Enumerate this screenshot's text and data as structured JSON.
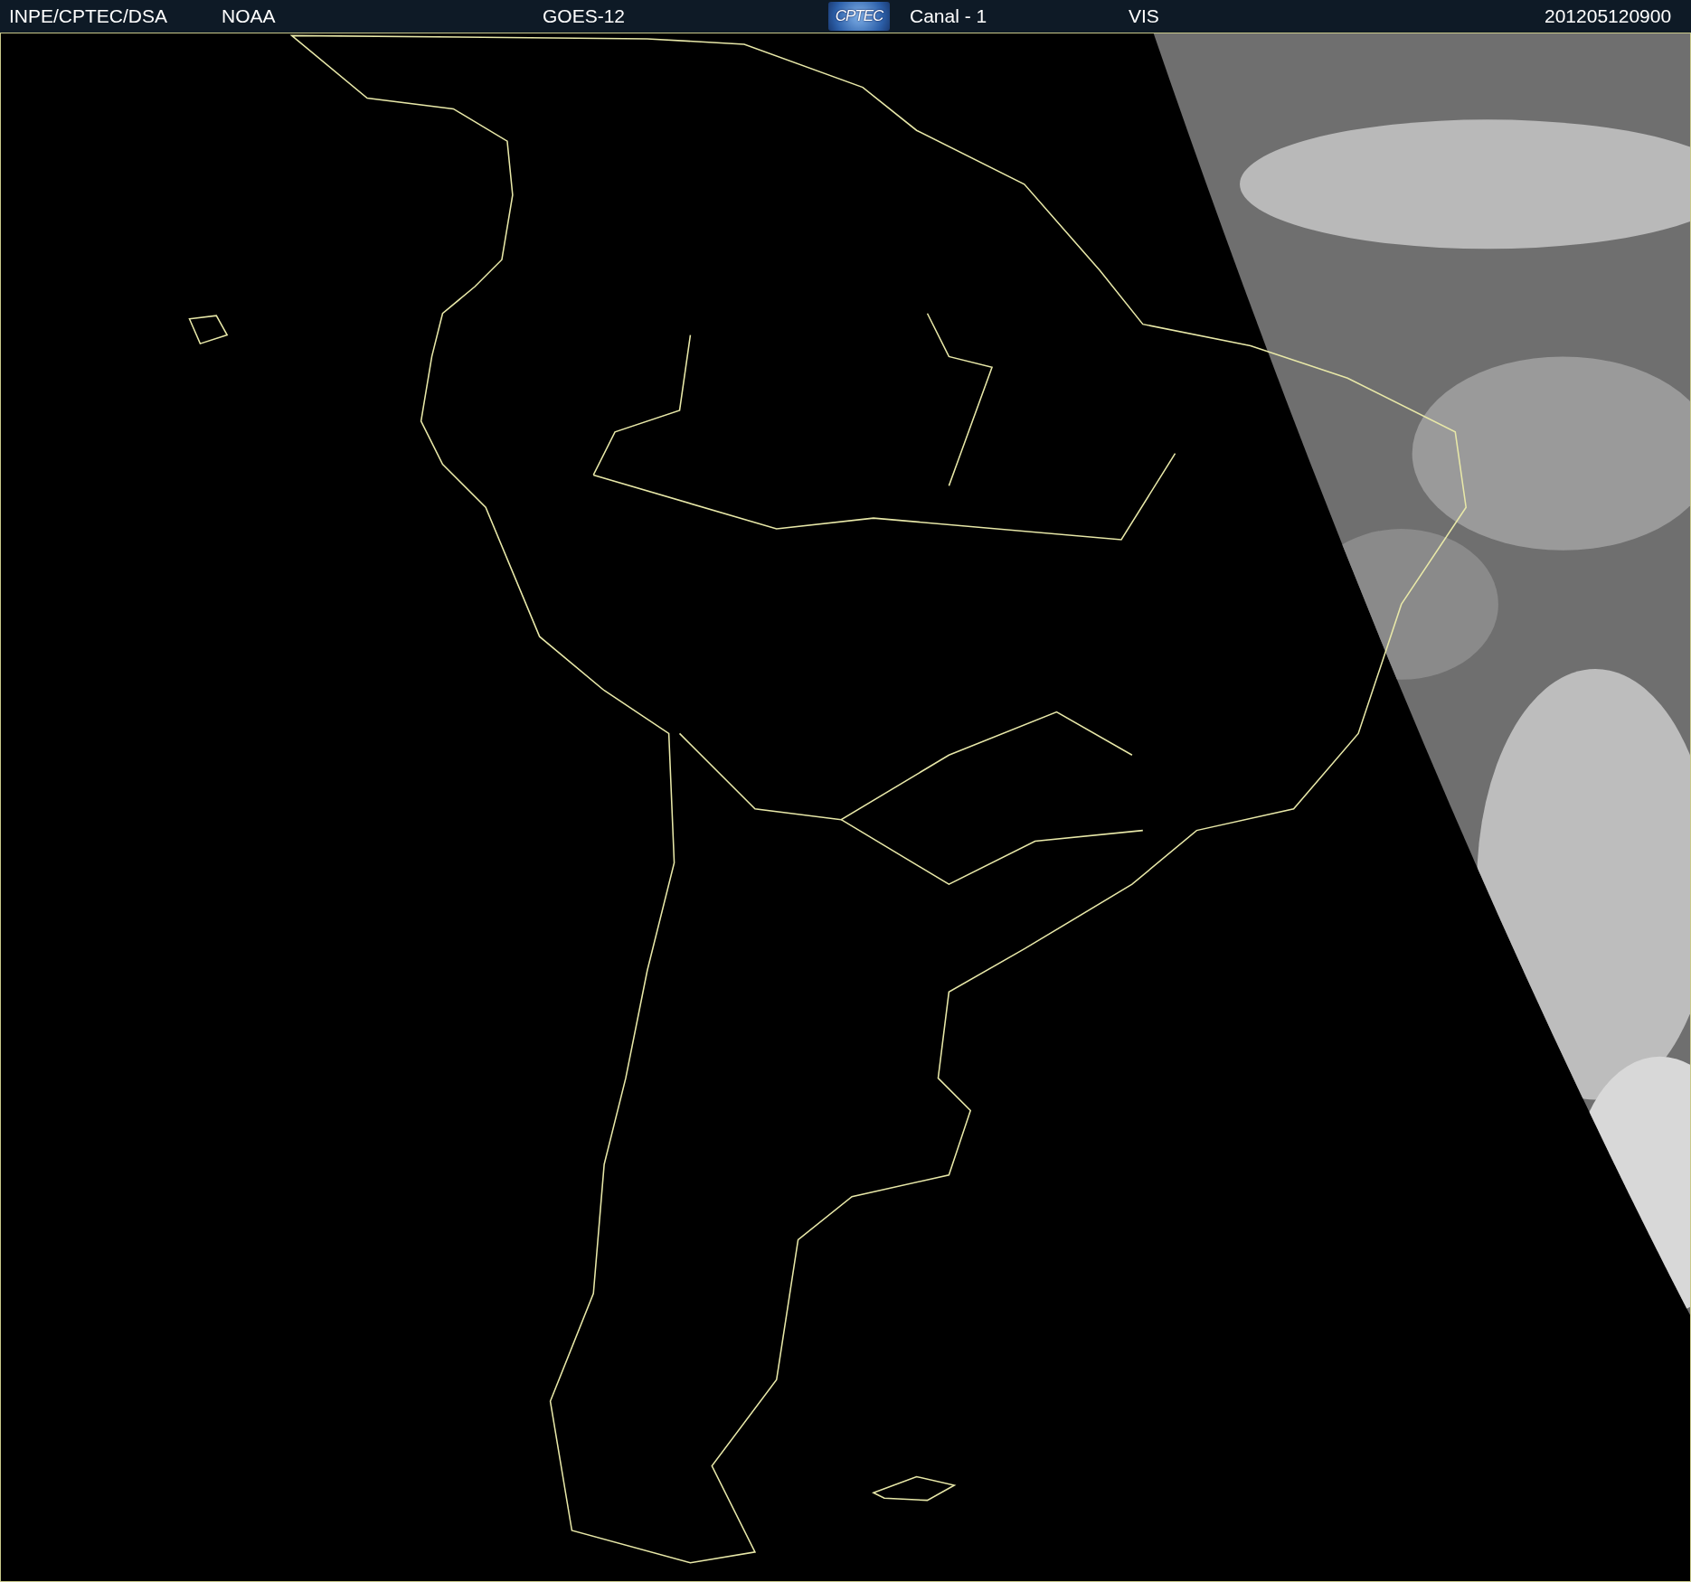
{
  "header": {
    "items": [
      "INPE/CPTEC/DSA",
      "NOAA",
      "GOES-12"
    ],
    "logo": "CPTEC",
    "right_items": [
      "Canal - 1",
      "VIS"
    ],
    "timestamp": "201205120900"
  }
}
